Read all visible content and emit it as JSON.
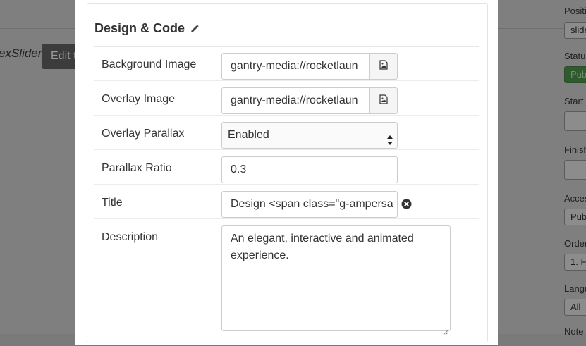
{
  "background": {
    "page_title": "exSlider",
    "edit_button_label": "Edit t",
    "sidebar": [
      {
        "label": "Positi",
        "value": "slide"
      },
      {
        "label": "Status",
        "value": "Pub"
      },
      {
        "label": "Start",
        "value": ""
      },
      {
        "label": "Finish",
        "value": ""
      },
      {
        "label": "Acces",
        "value": "Pub"
      },
      {
        "label": "Order",
        "value": "1. F"
      },
      {
        "label": "Langu",
        "value": "All"
      },
      {
        "label": "Note"
      }
    ]
  },
  "modal": {
    "section_title": "Design & Code",
    "fields": {
      "background_image": {
        "label": "Background Image",
        "value": "gantry-media://rocketlaun"
      },
      "overlay_image": {
        "label": "Overlay Image",
        "value": "gantry-media://rocketlaun"
      },
      "overlay_parallax": {
        "label": "Overlay Parallax",
        "value": "Enabled"
      },
      "parallax_ratio": {
        "label": "Parallax Ratio",
        "value": "0.3"
      },
      "title": {
        "label": "Title",
        "value": "Design <span class=\"g-ampersa"
      },
      "description": {
        "label": "Description",
        "value": "An elegant, interactive and animated experience."
      }
    }
  },
  "icons": {
    "edit": "pencil-icon",
    "image_picker": "image-file-icon",
    "clear": "close-circle-icon",
    "select": "up-down-arrows-icon"
  }
}
